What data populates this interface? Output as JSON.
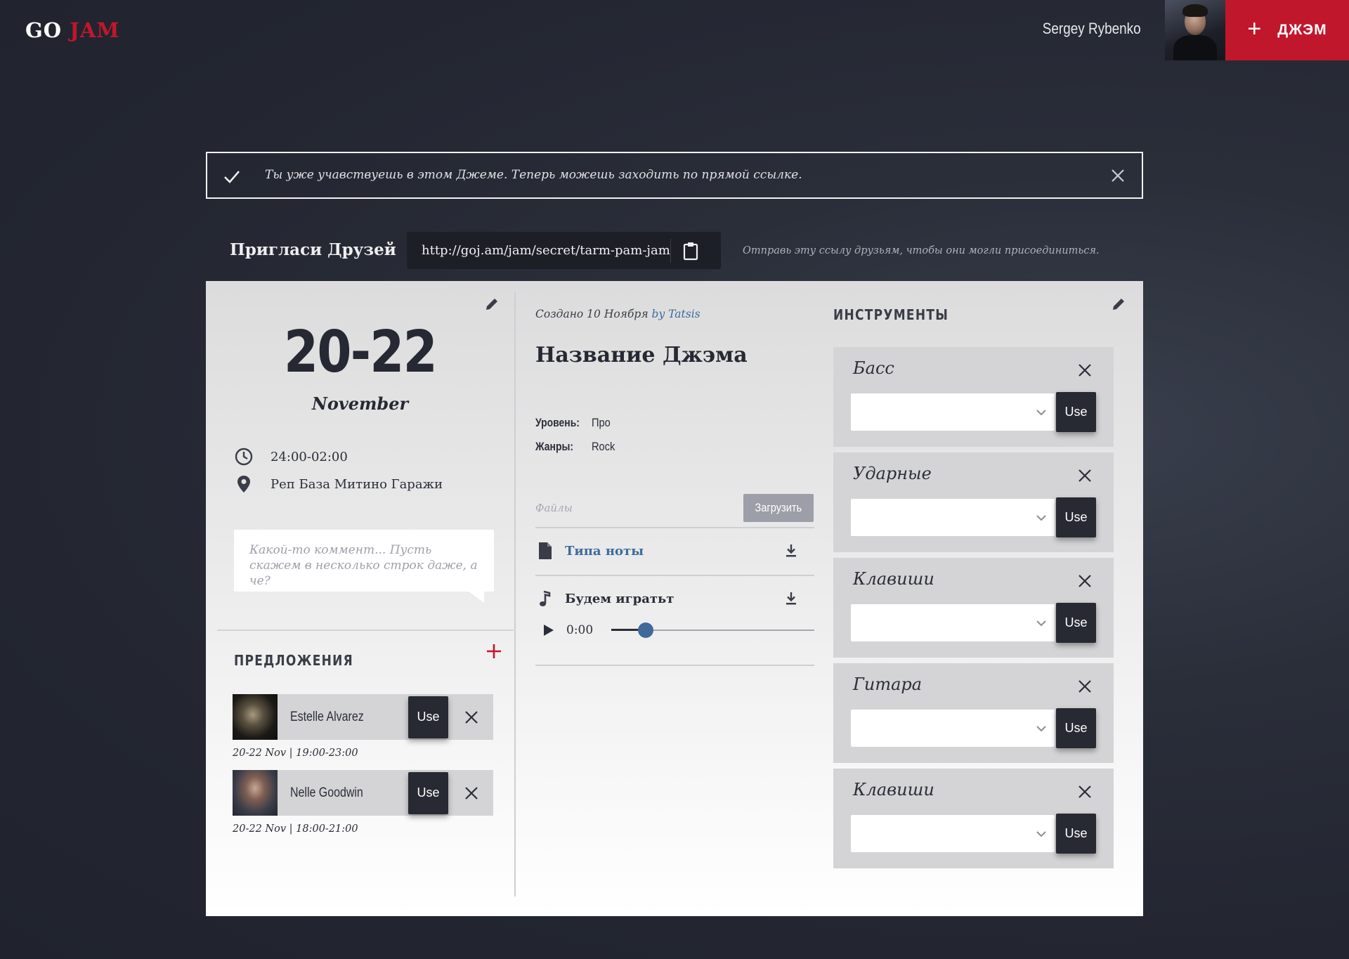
{
  "header": {
    "logo_go": "GO",
    "logo_jam": "JAM",
    "user_name": "Sergey Rybenko",
    "new_jam_label": "ДЖЭМ",
    "brand_color": "#c0172c"
  },
  "notice": {
    "message": "Ты уже учавствуешь в этом Джеме. Теперь можешь заходить по прямой ссылке."
  },
  "invite": {
    "title": "Пригласи Друзей",
    "url": "http://goj.am/jam/secret/tarm-pam-jam l",
    "hint": "Отправь эту ссылу друзьям, чтобы они могли присоединиться."
  },
  "event": {
    "date_range": "20-22",
    "month": "November",
    "time": "24:00-02:00",
    "place": "Реп База Митино Гаражи",
    "comment": "Какой-то коммент... Пусть скажем в несколько строк даже, а че?"
  },
  "offers": {
    "title": "ПРЕДЛОЖЕНИЯ",
    "use_label": "Use",
    "items": [
      {
        "name": "Estelle Alvarez",
        "date": "20-22 Nov",
        "time": "| 19:00-23:00"
      },
      {
        "name": "Nelle Goodwin",
        "date": "20-22 Nov",
        "time": "| 18:00-21:00"
      }
    ]
  },
  "jam": {
    "created_prefix": "Создано 10 Ноября",
    "created_by": "by Tatsis",
    "title": "Название Джэма",
    "level_label": "Уровень:",
    "level_value": "Про",
    "genres_label": "Жанры:",
    "genres_value": "Rock",
    "files_label": "Файлы",
    "upload_label": "Загрузить",
    "files": [
      {
        "name": "Типа ноты",
        "icon": "document-icon"
      },
      {
        "name": "Будем игратьт",
        "icon": "music-note-icon"
      }
    ],
    "player": {
      "time": "0:00",
      "progress": 0.17
    }
  },
  "instruments": {
    "title": "ИНСТРУМЕНТЫ",
    "use_label": "Use",
    "items": [
      {
        "name": "Басс"
      },
      {
        "name": "Ударные"
      },
      {
        "name": "Клавиши"
      },
      {
        "name": "Гитара"
      },
      {
        "name": "Клавиши"
      }
    ]
  }
}
